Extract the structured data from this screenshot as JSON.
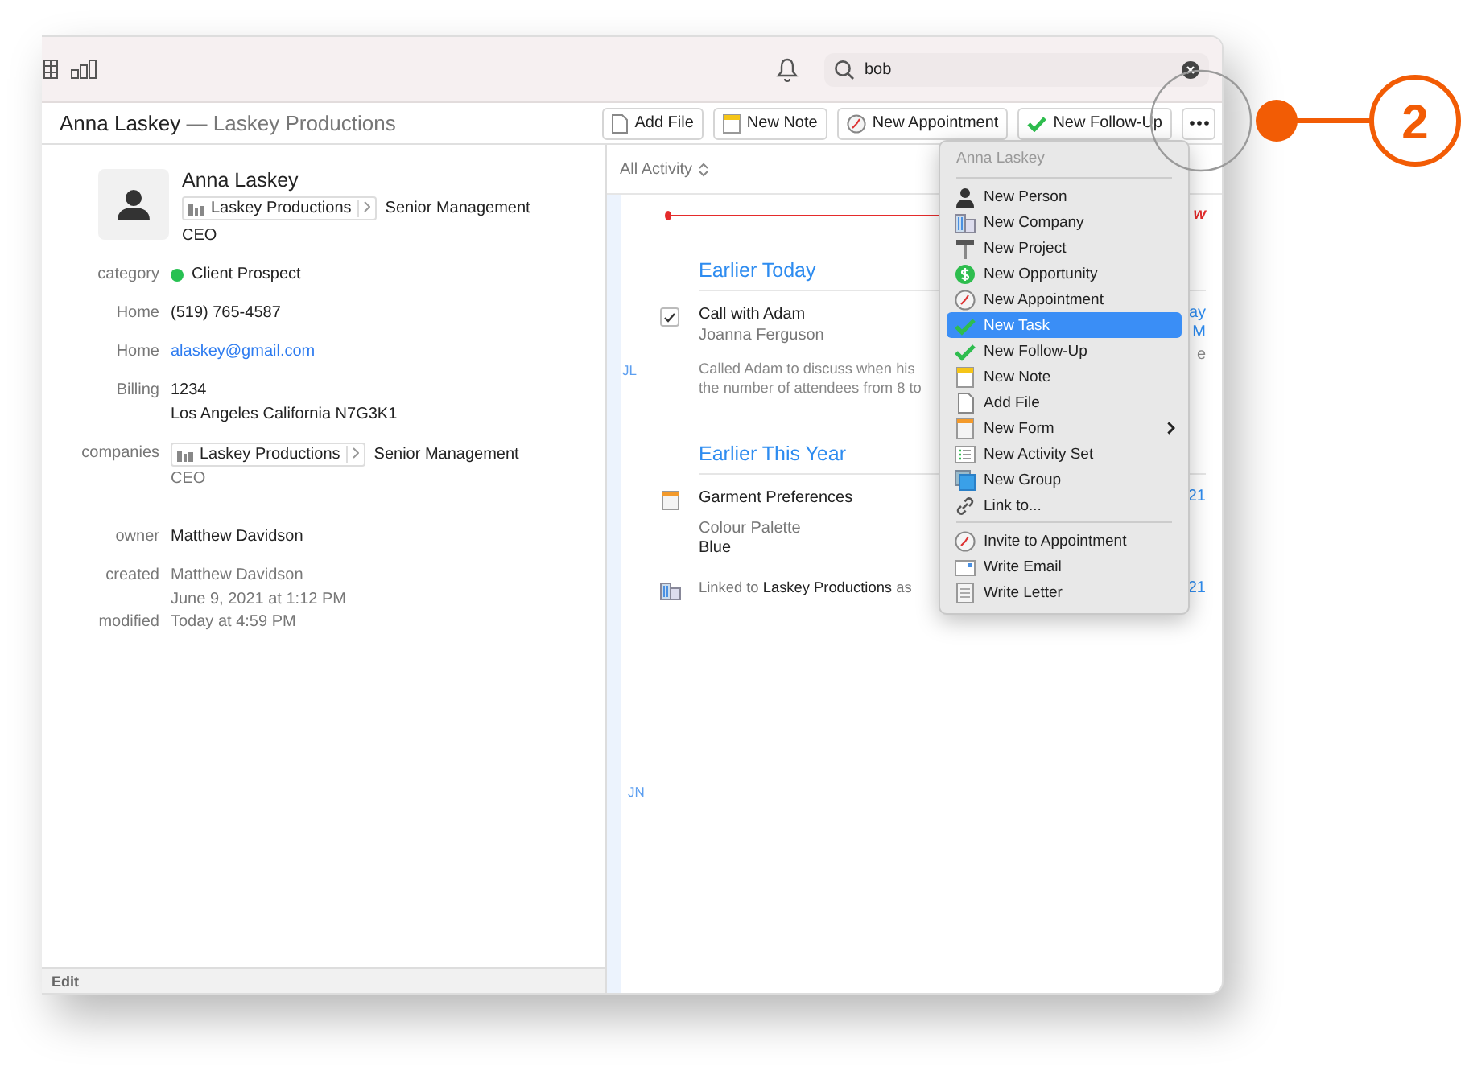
{
  "toolbar": {
    "search": {
      "value": "bob"
    }
  },
  "header": {
    "name": "Anna Laskey",
    "company": "— Laskey Productions"
  },
  "actions": [
    {
      "label": "Add File",
      "kind": "file"
    },
    {
      "label": "New Note",
      "kind": "note"
    },
    {
      "label": "New Appointment",
      "kind": "appointment"
    },
    {
      "label": "New Follow-Up",
      "kind": "check"
    }
  ],
  "contact": {
    "name": "Anna Laskey",
    "company": "Laskey Productions",
    "role": "Senior Management",
    "title": "CEO"
  },
  "fields": [
    {
      "label": "category",
      "kind": "category",
      "value": "Client Prospect",
      "color": "#27c152"
    },
    {
      "label": "Home",
      "kind": "text",
      "lines": [
        "(519) 765-4587"
      ]
    },
    {
      "label": "Home",
      "kind": "link",
      "lines": [
        "alaskey@gmail.com"
      ]
    },
    {
      "label": "Billing",
      "kind": "text",
      "lines": [
        "1234",
        "Los Angeles  California N7G3K1"
      ]
    },
    {
      "label": "companies",
      "kind": "company",
      "company": "Laskey Productions",
      "role": "Senior Management",
      "title": "CEO"
    },
    {
      "label": "owner",
      "kind": "text",
      "lines": [
        "Matthew Davidson"
      ]
    },
    {
      "label": "created",
      "kind": "muted",
      "lines": [
        "Matthew Davidson",
        "June 9, 2021 at 1:12 PM"
      ]
    },
    {
      "label": "modified",
      "kind": "muted",
      "lines": [
        "Today at 4:59 PM"
      ]
    }
  ],
  "footer": {
    "label": "Edit"
  },
  "activity": {
    "filter": "All Activity",
    "now": "w",
    "sections": [
      {
        "title": "Earlier Today",
        "items": [
          {
            "kind": "task",
            "checked": true,
            "title": "Call with Adam",
            "subtitle": "Joanna Ferguson",
            "body": [
              "Called Adam to discuss when his",
              "the number of attendees from 8 to"
            ],
            "side": [
              "ay",
              "M",
              "e"
            ],
            "initials": "JL"
          }
        ]
      },
      {
        "title": "Earlier This Year",
        "items": [
          {
            "kind": "form",
            "title": "Garment Preferences",
            "field": "Colour Palette",
            "value": "Blue",
            "side": [
              "21"
            ]
          },
          {
            "kind": "link",
            "text": "Linked to **Laskey Productions** as",
            "side": [
              "21"
            ]
          }
        ]
      }
    ],
    "trailing_initials": "JN"
  },
  "menu": {
    "header": "Anna Laskey",
    "groups": [
      [
        {
          "label": "New Person",
          "kind": "person",
          "selected": false
        },
        {
          "label": "New Company",
          "kind": "company",
          "selected": false
        },
        {
          "label": "New Project",
          "kind": "project",
          "selected": false
        },
        {
          "label": "New Opportunity",
          "kind": "money",
          "selected": false
        },
        {
          "label": "New Appointment",
          "kind": "clock",
          "selected": false
        },
        {
          "label": "New Task",
          "kind": "check",
          "selected": true
        },
        {
          "label": "New Follow-Up",
          "kind": "check",
          "selected": false
        },
        {
          "label": "New Note",
          "kind": "note",
          "selected": false
        },
        {
          "label": "Add File",
          "kind": "file",
          "selected": false
        },
        {
          "label": "New Form",
          "kind": "form",
          "selected": false,
          "submenu": true
        },
        {
          "label": "New Activity Set",
          "kind": "list",
          "selected": false
        },
        {
          "label": "New Group",
          "kind": "group",
          "selected": false
        },
        {
          "label": "Link to...",
          "kind": "link",
          "selected": false
        }
      ],
      [
        {
          "label": "Invite to Appointment",
          "kind": "clock",
          "selected": false
        },
        {
          "label": "Write Email",
          "kind": "email",
          "selected": false
        },
        {
          "label": "Write Letter",
          "kind": "letter",
          "selected": false
        }
      ]
    ]
  },
  "callout": {
    "number": "2"
  }
}
